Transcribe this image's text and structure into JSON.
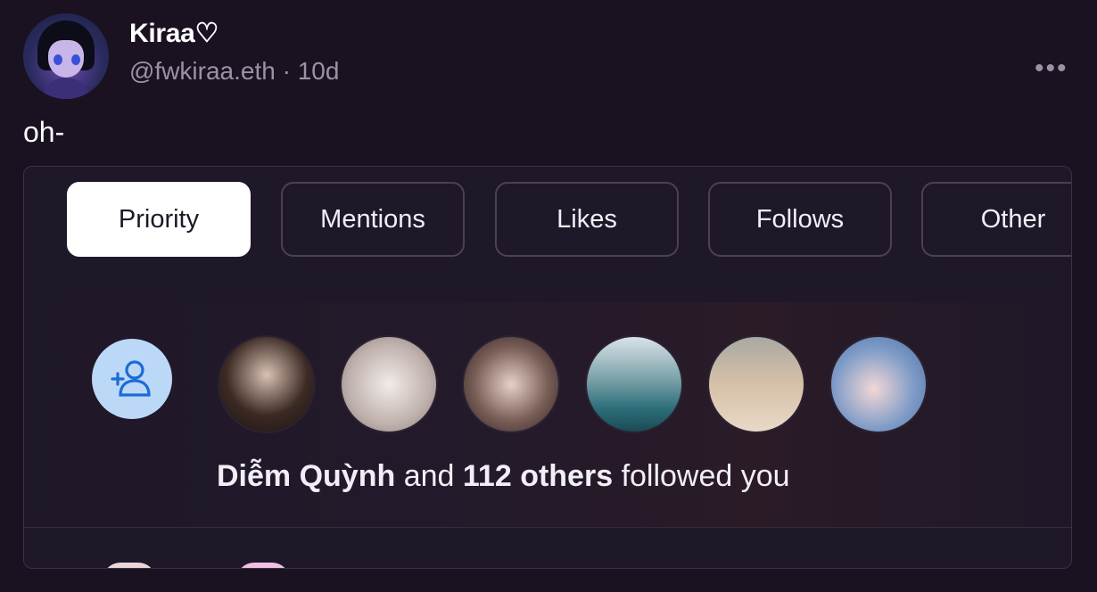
{
  "post": {
    "display_name": "Kiraa♡",
    "handle": "@fwkiraa.eth",
    "separator": "·",
    "time": "10d",
    "more": "•••",
    "text": "oh-"
  },
  "embed": {
    "tabs": [
      {
        "label": "Priority",
        "active": true
      },
      {
        "label": "Mentions",
        "active": false
      },
      {
        "label": "Likes",
        "active": false
      },
      {
        "label": "Follows",
        "active": false
      },
      {
        "label": "Other",
        "active": false
      }
    ],
    "notification": {
      "name": "Diễm Quỳnh",
      "connector": "and",
      "others": "112 others",
      "action": "followed you",
      "icon": "add-person-icon"
    }
  },
  "colors": {
    "background": "#1a1221",
    "icon_bg": "#bcd8f7",
    "icon_fg": "#1d6bd6",
    "muted": "#9a93a3"
  }
}
